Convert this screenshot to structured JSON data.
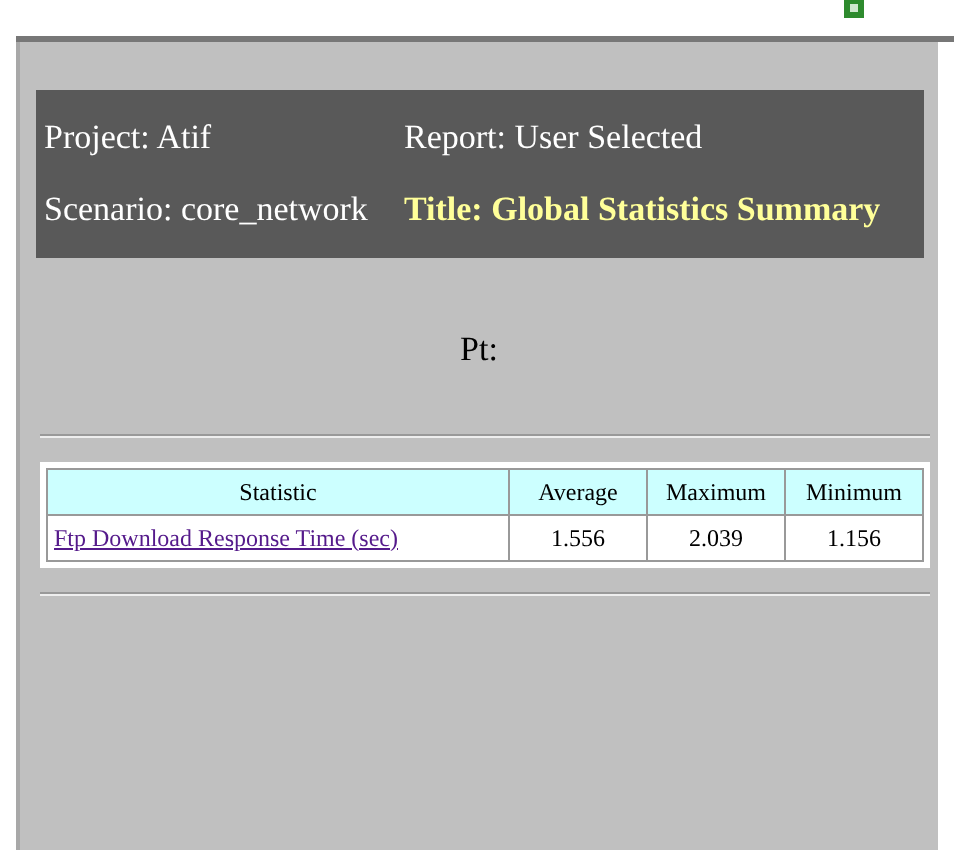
{
  "header": {
    "project": "Project: Atif",
    "report": "Report: User Selected",
    "scenario": "Scenario: core_network",
    "title": "Title: Global Statistics Summary"
  },
  "caption": "Pt:",
  "table": {
    "columns": [
      "Statistic",
      "Average",
      "Maximum",
      "Minimum"
    ],
    "rows": [
      {
        "cells": [
          "Ftp Download Response Time (sec)",
          "1.556",
          "2.039",
          "1.156"
        ]
      }
    ]
  }
}
